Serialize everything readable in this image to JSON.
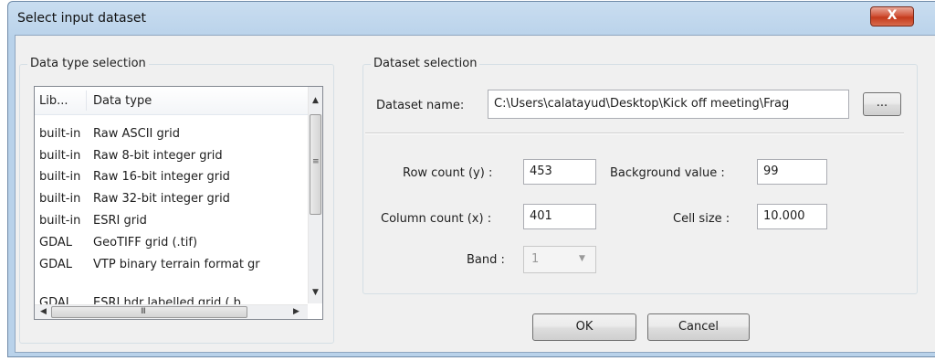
{
  "window": {
    "title": "Select input dataset",
    "close_glyph": "X"
  },
  "data_type_group": {
    "legend": "Data type selection",
    "columns": [
      "Lib...",
      "Data type"
    ],
    "rows": [
      {
        "lib": "built-in",
        "type": "Raw ASCII grid"
      },
      {
        "lib": "built-in",
        "type": "Raw 8-bit integer grid"
      },
      {
        "lib": "built-in",
        "type": "Raw 16-bit integer grid"
      },
      {
        "lib": "built-in",
        "type": "Raw 32-bit integer grid"
      },
      {
        "lib": "built-in",
        "type": "ESRI grid"
      },
      {
        "lib": "GDAL",
        "type": "GeoTIFF grid (.tif)"
      },
      {
        "lib": "GDAL",
        "type": "VTP binary terrain format gr"
      },
      {
        "lib": "GDAL",
        "type": "ESRI hdr labelled grid (.b"
      }
    ]
  },
  "dataset_group": {
    "legend": "Dataset selection",
    "dataset_name_label": "Dataset name:",
    "dataset_name_value": "C:\\Users\\calatayud\\Desktop\\Kick off meeting\\Frag",
    "browse_label": "...",
    "row_count_label": "Row count (y) :",
    "row_count_value": "453",
    "background_label": "Background value :",
    "background_value": "99",
    "column_count_label": "Column count (x) :",
    "column_count_value": "401",
    "cell_size_label": "Cell size :",
    "cell_size_value": "10.000",
    "band_label": "Band :",
    "band_value": "1"
  },
  "buttons": {
    "ok": "OK",
    "cancel": "Cancel"
  },
  "scroll_glyphs": {
    "up": "▲",
    "down": "▼",
    "left": "◀",
    "right": "▶",
    "grip_v": "≡",
    "grip_h": "III"
  }
}
